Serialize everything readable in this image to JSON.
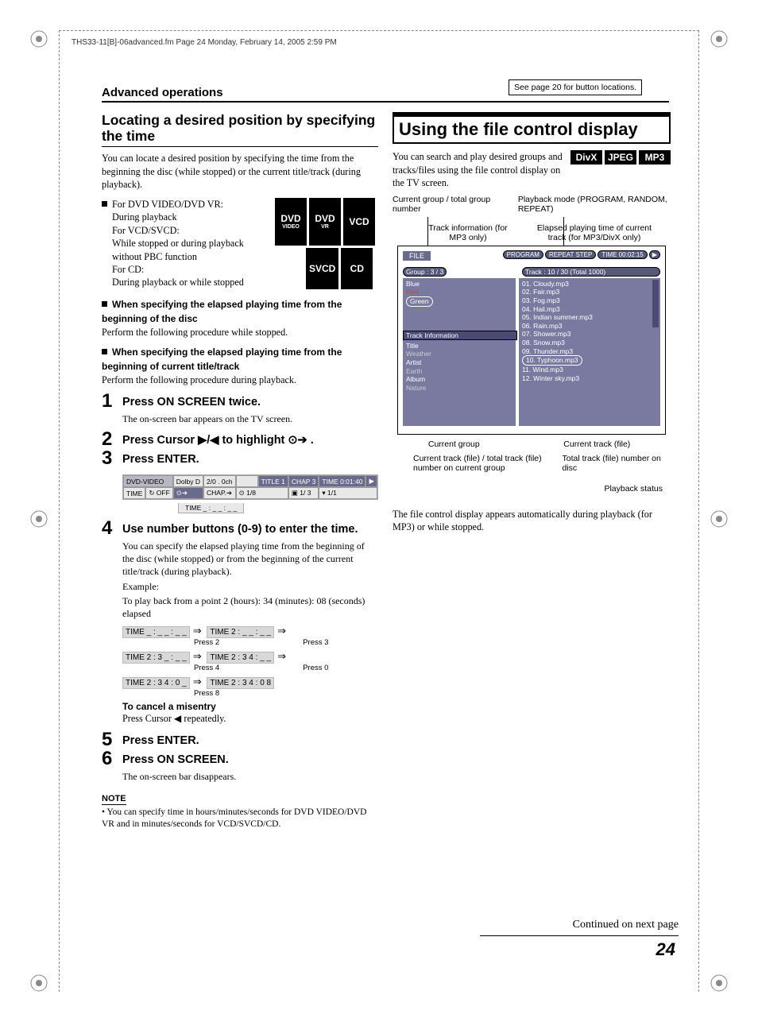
{
  "meta": {
    "headerline": "THS33-11[B]-06advanced.fm  Page 24  Monday, February 14, 2005  2:59 PM"
  },
  "header": {
    "section": "Advanced operations",
    "locbox": "See page 20 for button locations."
  },
  "left": {
    "h1": "Locating a desired position by specifying the time",
    "intro": "You can locate a desired position by specifying the time from the beginning the disc (while stopped) or the current title/track (during playback).",
    "discs": {
      "l1": "For DVD VIDEO/DVD VR:",
      "l2": "During playback",
      "l3": "For VCD/SVCD:",
      "l4": "While stopped or during playback without PBC function",
      "l5": "For CD:",
      "l6": "During playback or while stopped"
    },
    "badges": {
      "b1": "DVD",
      "b1s": "VIDEO",
      "b2": "DVD",
      "b2s": "VR",
      "b3": "VCD",
      "b4": "SVCD",
      "b5": "CD"
    },
    "sub1": "When specifying the elapsed playing time from the beginning of the disc",
    "sub1b": "Perform the following procedure while stopped.",
    "sub2": "When specifying the elapsed playing time from the beginning of current title/track",
    "sub2b": "Perform the following procedure during playback.",
    "s1": {
      "t": "Press ON SCREEN twice.",
      "b": "The on-screen bar appears on the TV screen."
    },
    "s2": {
      "t": "Press Cursor ▶/◀ to highlight ⊙➔ ."
    },
    "s3": {
      "t": "Press ENTER."
    },
    "bar": {
      "r1c1": "DVD-VIDEO",
      "r1c2": "Dolby D",
      "r1c3": "2/0 . 0ch",
      "r1c4": "TITLE  1",
      "r1c5": "CHAP  3",
      "r1c6": "TIME  0:01:40",
      "r1c7": "▶",
      "r2c1": "TIME",
      "r2c2": "↻ OFF",
      "r2c3": "⊙➔",
      "r2c4": "CHAP.➔",
      "r2c5": "⊙ 1/8",
      "r2c6": "▣ 1/ 3",
      "r2c7": "▾ 1/1",
      "r3": "TIME   _ : _ _  :  _ _"
    },
    "s4": {
      "t": "Use number buttons (0-9) to enter the time.",
      "b1": "You can specify the elapsed playing time from the beginning of the disc (while stopped) or from the beginning of the current title/track (during playback).",
      "ex": "Example:",
      "b2": "To play back from a point 2 (hours): 34 (minutes): 08 (seconds) elapsed"
    },
    "seq": {
      "a1": "TIME    _ : _ _ : _ _",
      "a1l": "Press 2",
      "a2": "TIME   2 : _ _ : _ _",
      "a2l": "Press 3",
      "b1": "TIME   2 : 3 _ : _ _",
      "b1l": "Press 4",
      "b2": "TIME   2 : 3 4 : _ _",
      "b2l": "Press 0",
      "c1": "TIME   2 : 3 4 : 0 _",
      "c1l": "Press 8",
      "c2": "TIME   2 : 3 4 : 0 8"
    },
    "cancel_t": "To cancel a misentry",
    "cancel_b": "Press Cursor ◀ repeatedly.",
    "s5": {
      "t": "Press ENTER."
    },
    "s6": {
      "t": "Press ON SCREEN.",
      "b": "The on-screen bar disappears."
    },
    "note": "NOTE",
    "note_b": "You can specify time in hours/minutes/seconds for DVD VIDEO/DVD VR and in minutes/seconds for VCD/SVCD/CD."
  },
  "right": {
    "h1": "Using the file control display",
    "intro": "You can search and play desired groups and tracks/files using the file control display on the TV screen.",
    "badges": {
      "b1": "DivX",
      "b2": "JPEG",
      "b3": "MP3"
    },
    "annot": {
      "a1": "Current group / total group number",
      "a2": "Playback mode (PROGRAM, RANDOM, REPEAT)",
      "a3": "Track information (for MP3 only)",
      "a4": "Elapsed playing time of current track (for MP3/DivX only)",
      "a5": "Current group",
      "a6": "Current track (file)",
      "a7": "Current track (file) / total track (file) number on current group",
      "a8": "Total track (file) number on disc",
      "a9": "Playback status"
    },
    "fcd": {
      "file": "FILE",
      "pills": {
        "p1": "PROGRAM",
        "p2": "REPEAT STEP",
        "p3": "TIME 00:02:15"
      },
      "play": "▶",
      "group": "Group :  3 / 3",
      "track": "Track :  10  /  30   (Total  1000)",
      "groups": [
        "Blue",
        "Red",
        "Green"
      ],
      "trackinfo": {
        "h": "Track  Information",
        "r1l": "Title",
        "r1v": "Weather",
        "r2l": "Artist",
        "r2v": "Earth",
        "r3l": "Album",
        "r3v": "Nature"
      },
      "files": [
        "01. Cloudy.mp3",
        "02. Fair.mp3",
        "03. Fog.mp3",
        "04. Hail.mp3",
        "05. Indian summer.mp3",
        "06. Rain.mp3",
        "07. Shower.mp3",
        "08. Snow.mp3",
        "09. Thunder.mp3",
        "10. Typhoon.mp3",
        "11. Wind.mp3",
        "12. Winter sky.mp3"
      ]
    },
    "outro": "The file control display appears automatically during playback (for MP3) or while stopped."
  },
  "footer": {
    "cont": "Continued on next page",
    "page": "24"
  }
}
